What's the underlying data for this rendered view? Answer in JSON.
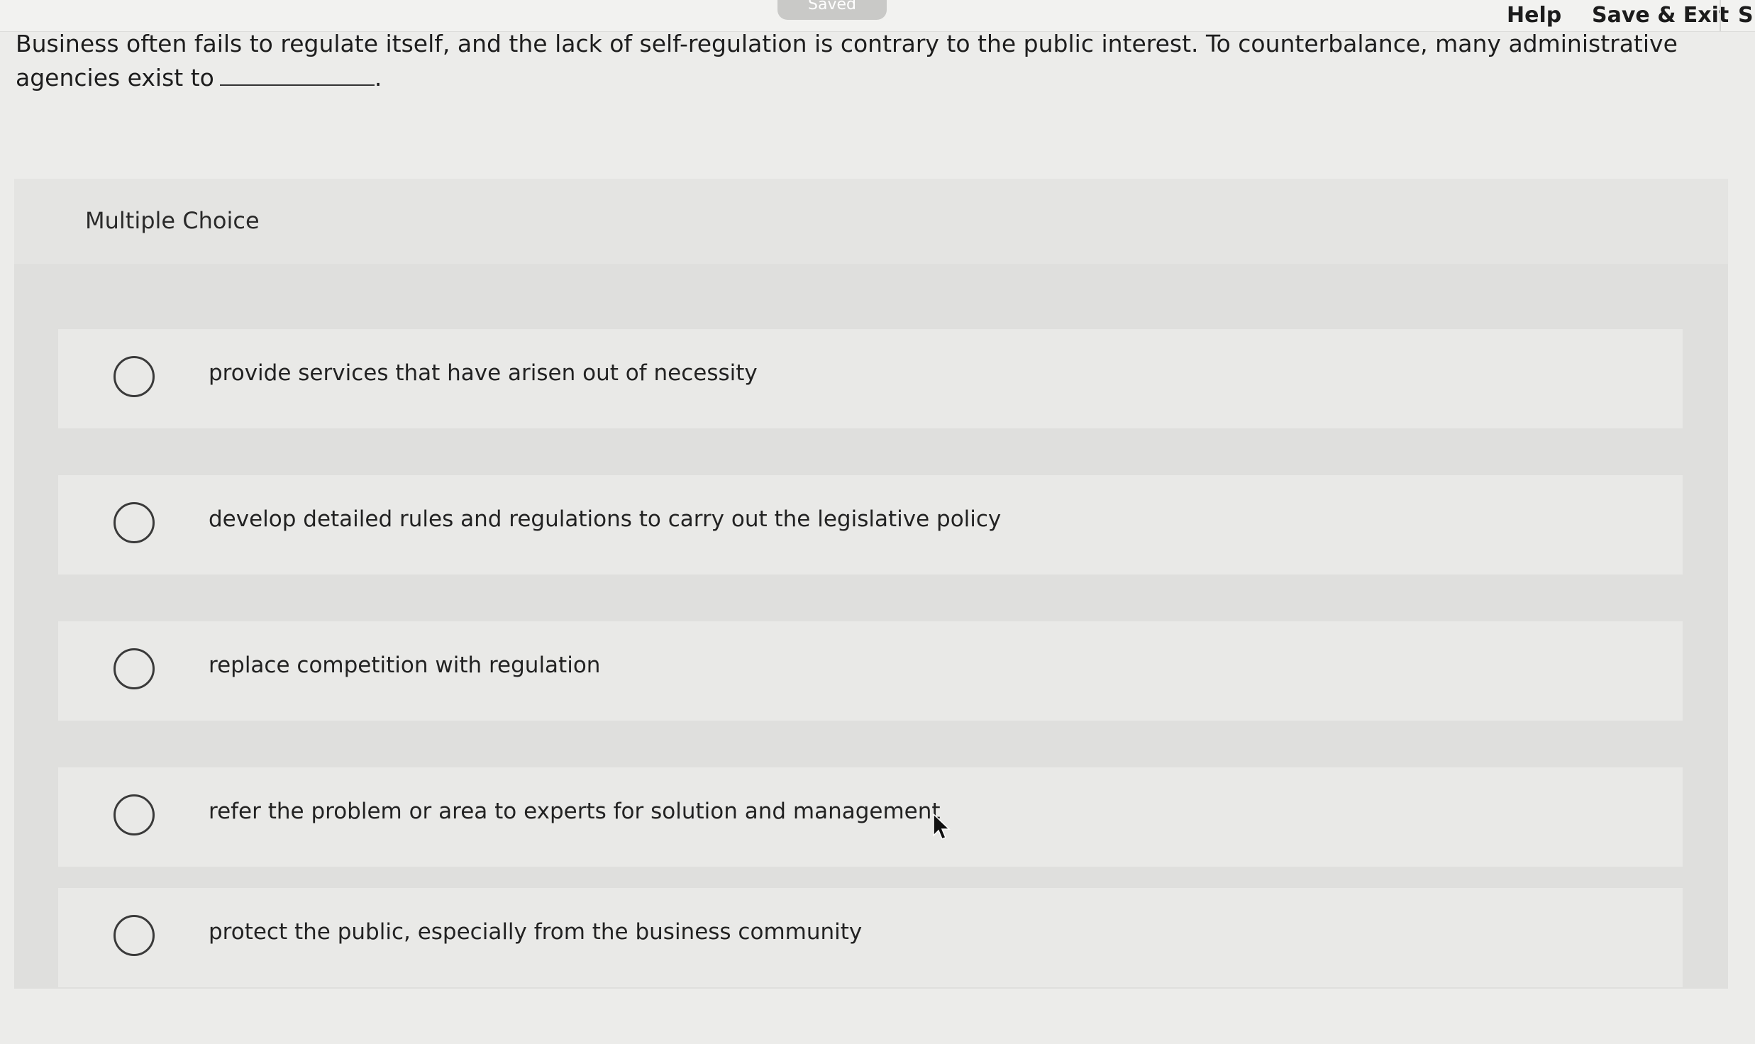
{
  "topbar": {
    "saved_label": "Saved",
    "help_label": "Help",
    "save_exit_label": "Save & Exit",
    "cut_label": "S"
  },
  "question": {
    "text": "Business often fails to regulate itself, and the lack of self-regulation is contrary to the public interest. To counterbalance, many administrative agencies exist to",
    "blank_suffix": "."
  },
  "multiple_choice": {
    "heading": "Multiple Choice",
    "choices": [
      {
        "label": "provide services that have arisen out of necessity"
      },
      {
        "label": "develop detailed rules and regulations to carry out the legislative policy"
      },
      {
        "label": "replace competition with regulation"
      },
      {
        "label": "refer the problem or area to experts for solution and management"
      },
      {
        "label": "protect the public, especially from the business community"
      }
    ]
  },
  "icons": {
    "radio": "radio-button-icon",
    "cursor": "mouse-pointer-icon"
  }
}
